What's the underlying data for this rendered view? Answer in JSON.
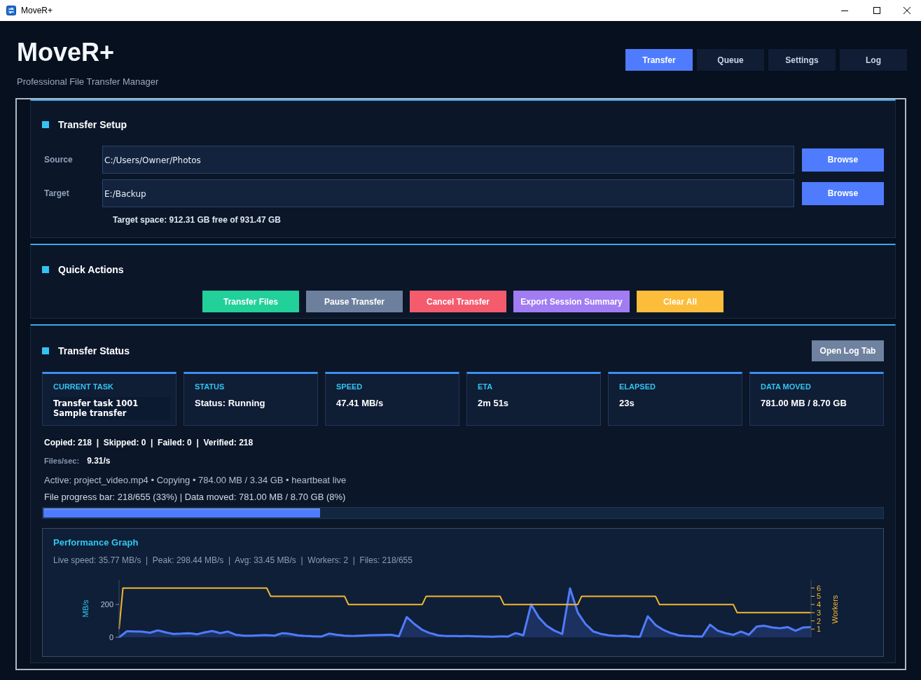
{
  "window": {
    "title": "MoveR+"
  },
  "header": {
    "title": "MoveR+",
    "subtitle": "Professional File Transfer Manager"
  },
  "tabs": [
    {
      "label": "Transfer",
      "selected": true
    },
    {
      "label": "Queue",
      "selected": false
    },
    {
      "label": "Settings",
      "selected": false
    },
    {
      "label": "Log",
      "selected": false
    }
  ],
  "transfer_setup": {
    "title": "Transfer Setup",
    "fields": [
      {
        "label": "Source",
        "value": "C:/Users/Owner/Photos",
        "button": "Browse"
      },
      {
        "label": "Target",
        "value": "E:/Backup",
        "button": "Browse"
      }
    ],
    "target_space": "Target space: 912.31 GB free of 931.47 GB"
  },
  "quick_actions": {
    "title": "Quick Actions",
    "buttons": [
      {
        "label": "Transfer Files",
        "color": "#22d09a"
      },
      {
        "label": "Pause Transfer",
        "color": "#6c809e"
      },
      {
        "label": "Cancel Transfer",
        "color": "#f45b6d"
      },
      {
        "label": "Export Session Summary",
        "color": "#a27cf2"
      },
      {
        "label": "Clear All",
        "color": "#fbbd3a"
      }
    ]
  },
  "transfer_status": {
    "title": "Transfer Status",
    "button": "Open Log Tab",
    "cards": [
      {
        "kind": "textbox",
        "label": "CURRENT TASK",
        "value": "Transfer task 1001\nSample transfer"
      },
      {
        "kind": "text",
        "label": "STATUS",
        "value": "Status: Running"
      },
      {
        "kind": "text",
        "label": "SPEED",
        "value": "47.41 MB/s"
      },
      {
        "kind": "text",
        "label": "ETA",
        "value": "2m 51s"
      },
      {
        "kind": "text",
        "label": "ELAPSED",
        "value": "23s"
      },
      {
        "kind": "text",
        "label": "DATA MOVED",
        "value": "781.00 MB / 8.70 GB"
      }
    ],
    "counts": "Copied: 218  |  Skipped: 0  |  Failed: 0  |  Verified: 218",
    "files_per_sec": {
      "label": "Files/sec:",
      "value": "9.31/s"
    },
    "active": "Active: project_video.mp4 • Copying • 784.00 MB / 3.34 GB • heartbeat live",
    "progress_text": "File progress bar: 218/655 (33%) | Data moved: 781.00 MB / 8.70 GB (8%)",
    "progress": {
      "level": 0.33
    },
    "performance_graph": {
      "title": "Performance Graph",
      "stats": "Live speed: 35.77 MB/s  |  Peak: 298.44 MB/s  |  Avg: 33.45 MB/s  |  Workers: 2  |  Files: 218/655",
      "chart_data": {
        "type": "area",
        "ylabel": "MB/s",
        "ylim": [
          0,
          350
        ],
        "yticks": [
          0,
          200
        ],
        "y2label": "Workers",
        "y2lim": [
          0,
          7
        ],
        "y2ticks": [
          1,
          2,
          3,
          4,
          5,
          6
        ],
        "series": [
          {
            "type": "area",
            "color": "#4f7cff",
            "values": [
              0,
              18,
              36,
              36,
              35,
              35,
              34,
              31,
              28,
              35,
              42,
              36,
              30,
              25,
              20,
              21,
              22,
              24,
              25,
              22,
              18,
              24,
              30,
              34,
              38,
              32,
              25,
              30,
              35,
              25,
              15,
              13,
              10,
              10,
              10,
              11,
              12,
              13,
              13,
              12,
              10,
              18,
              25,
              23,
              20,
              16,
              12,
              10,
              8,
              7,
              5,
              5,
              4,
              13,
              22,
              19,
              15,
              13,
              10,
              9,
              8,
              9,
              10,
              11,
              12,
              13,
              13,
              14,
              14,
              15,
              15,
              11,
              6,
              65,
              123,
              102,
              80,
              63,
              45,
              35,
              25,
              19,
              12,
              10,
              8,
              8,
              8,
              7,
              6,
              7,
              7,
              6,
              5,
              5,
              4,
              4,
              3,
              4,
              5,
              5,
              4,
              15,
              25,
              19,
              12,
              106,
              200,
              160,
              120,
              95,
              70,
              55,
              40,
              30,
              20,
              159,
              298,
              224,
              150,
              115,
              80,
              58,
              35,
              28,
              20,
              16,
              12,
              10,
              8,
              9,
              10,
              7,
              4,
              4,
              3,
              66,
              128,
              102,
              75,
              60,
              45,
              35,
              25,
              19,
              12,
              10,
              8,
              7,
              5,
              5,
              4,
              41,
              77,
              59,
              40,
              33,
              25,
              20,
              15,
              25,
              35,
              25,
              15,
              40,
              65,
              68,
              70,
              65,
              60,
              58,
              55,
              59,
              62,
              51,
              40,
              50,
              60,
              61,
              62
            ]
          },
          {
            "type": "line",
            "axis": "y2",
            "color": "#f5b731",
            "values": [
              1,
              6,
              6,
              6,
              6,
              6,
              6,
              6,
              6,
              6,
              6,
              6,
              6,
              6,
              6,
              6,
              6,
              6,
              6,
              6,
              6,
              6,
              6,
              6,
              6,
              6,
              6,
              6,
              6,
              6,
              6,
              6,
              6,
              6,
              6,
              6,
              6,
              6,
              6,
              5,
              5,
              5,
              5,
              5,
              5,
              5,
              5,
              5,
              5,
              5,
              5,
              5,
              5,
              5,
              5,
              5,
              5,
              5,
              5,
              4,
              4,
              4,
              4,
              4,
              4,
              4,
              4,
              4,
              4,
              4,
              4,
              4,
              4,
              4,
              4,
              4,
              4,
              4,
              4,
              5,
              5,
              5,
              5,
              5,
              5,
              5,
              5,
              5,
              5,
              5,
              5,
              5,
              5,
              5,
              5,
              5,
              5,
              5,
              5,
              4,
              4,
              4,
              4,
              4,
              4,
              4,
              4,
              4,
              4,
              4,
              4,
              4,
              4,
              4,
              4,
              4,
              4,
              4,
              4,
              5,
              5,
              5,
              5,
              5,
              5,
              5,
              5,
              5,
              5,
              5,
              5,
              5,
              5,
              5,
              5,
              5,
              5,
              5,
              5,
              4,
              4,
              4,
              4,
              4,
              4,
              4,
              4,
              4,
              4,
              4,
              4,
              4,
              4,
              4,
              4,
              4,
              4,
              4,
              4,
              3,
              3,
              3,
              3,
              3,
              3,
              3,
              3,
              3,
              3,
              3,
              3,
              3,
              3,
              3,
              3,
              3,
              3,
              3,
              3
            ]
          }
        ]
      }
    }
  }
}
